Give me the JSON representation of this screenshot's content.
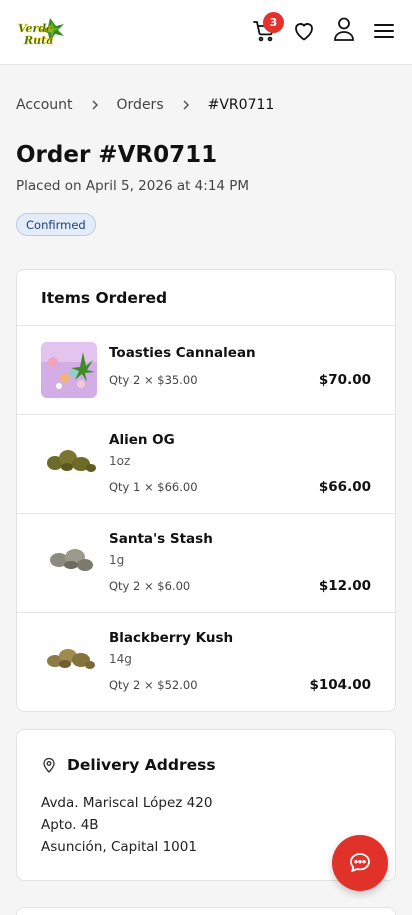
{
  "header": {
    "logo_text": "Verde Ruta",
    "cart_count": "3"
  },
  "breadcrumb": {
    "items": [
      "Account",
      "Orders"
    ],
    "current": "#VR0711"
  },
  "order": {
    "title": "Order #VR0711",
    "placed": "Placed on April 5, 2026 at 4:14 PM",
    "status": "Confirmed"
  },
  "items_card": {
    "title": "Items Ordered",
    "items": [
      {
        "name": "Toasties Cannalean",
        "variant": "",
        "qty": "Qty 2 × $35.00",
        "price": "$70.00"
      },
      {
        "name": "Alien OG",
        "variant": "1oz",
        "qty": "Qty 1 × $66.00",
        "price": "$66.00"
      },
      {
        "name": "Santa's Stash",
        "variant": "1g",
        "qty": "Qty 2 × $6.00",
        "price": "$12.00"
      },
      {
        "name": "Blackberry Kush",
        "variant": "14g",
        "qty": "Qty 2 × $52.00",
        "price": "$104.00"
      }
    ]
  },
  "address": {
    "title": "Delivery Address",
    "line1": "Avda. Mariscal López 420",
    "line2": "Apto. 4B",
    "line3": "Asunción, Capital 1001"
  },
  "colors": {
    "accent": "#e1322a",
    "badge_bg": "#e4ecfa",
    "badge_text": "#1d3f78"
  }
}
